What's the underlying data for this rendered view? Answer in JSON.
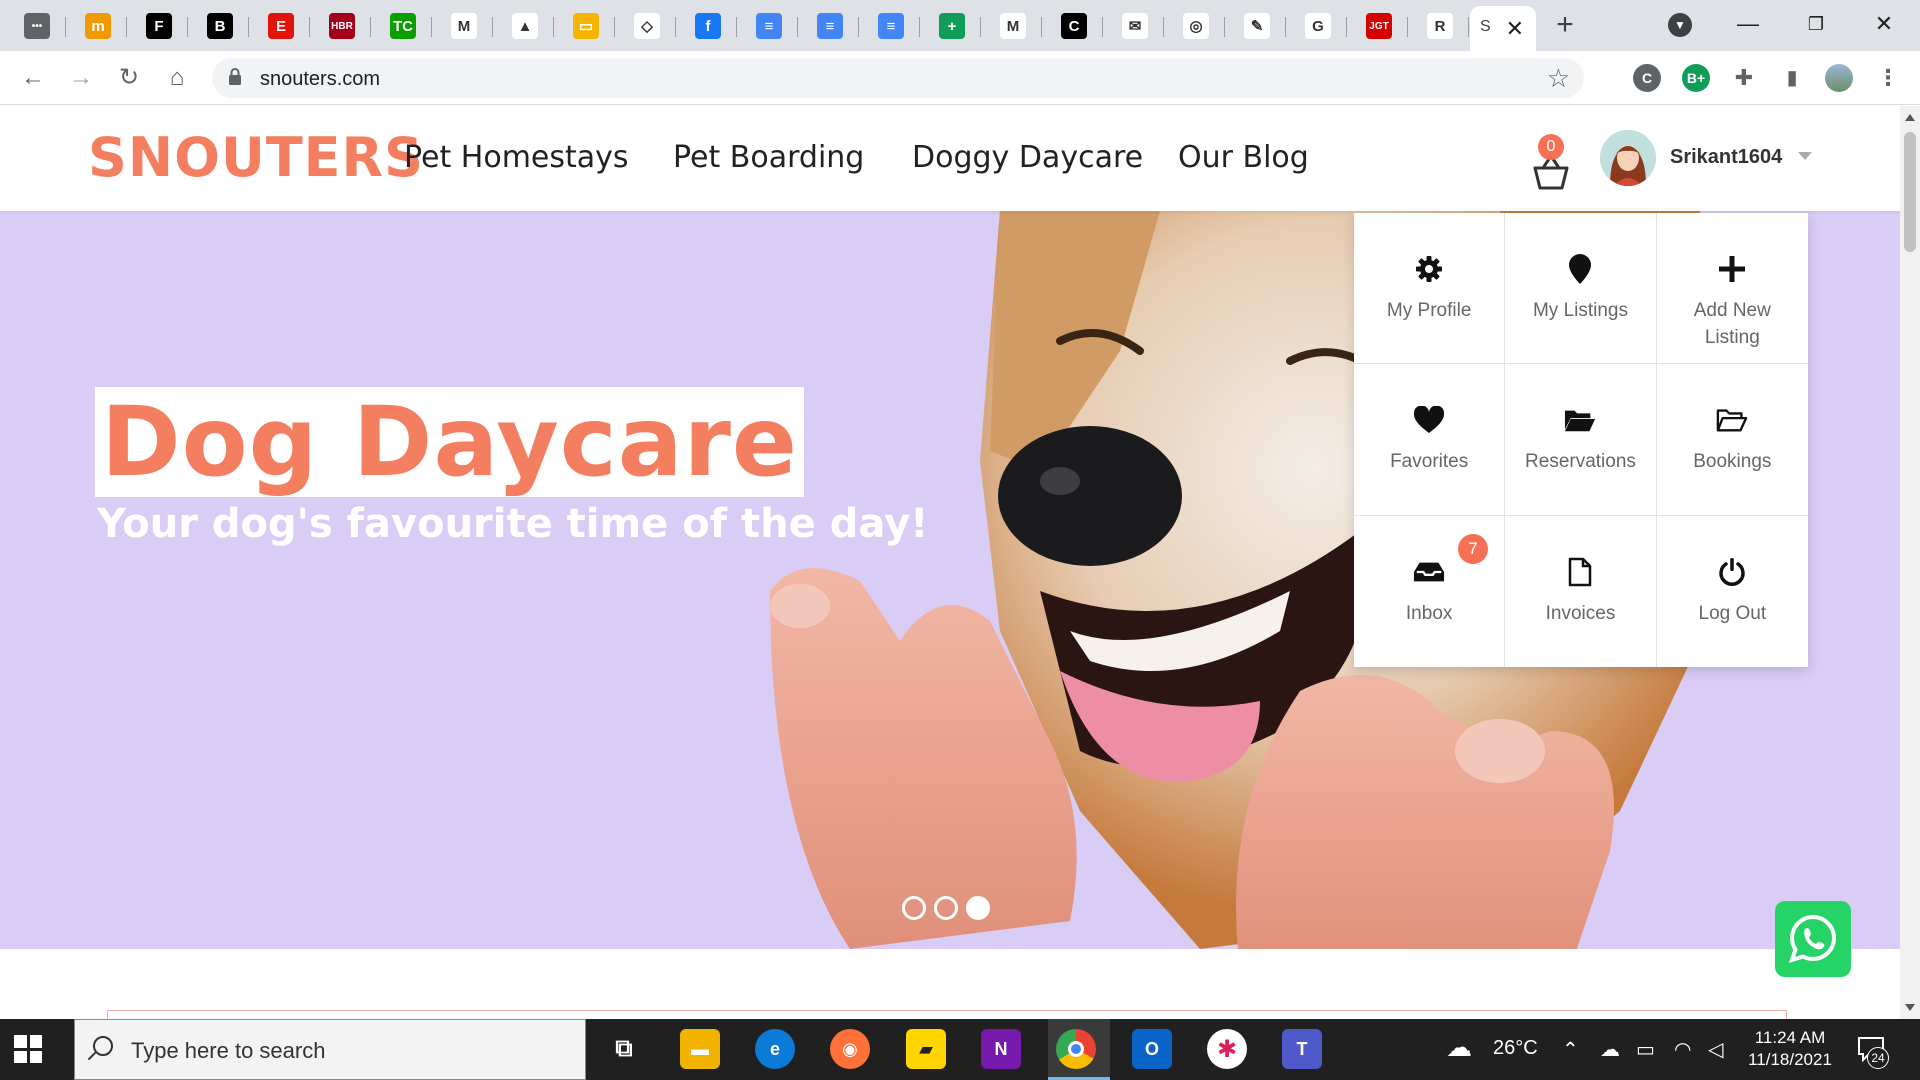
{
  "browser": {
    "tabs": [
      {
        "name": "apps",
        "glyph": "•••",
        "bg": "#5f6368"
      },
      {
        "name": "m",
        "glyph": "m",
        "bg": "#f29900"
      },
      {
        "name": "forbes",
        "glyph": "F",
        "bg": "#000000"
      },
      {
        "name": "b",
        "glyph": "B",
        "bg": "#000000"
      },
      {
        "name": "economist",
        "glyph": "E",
        "bg": "#e3120b"
      },
      {
        "name": "hbr",
        "glyph": "HBR",
        "bg": "#a4001c"
      },
      {
        "name": "techcrunch",
        "glyph": "TC",
        "bg": "#0a9e01"
      },
      {
        "name": "gmail",
        "glyph": "M",
        "bg": "#ffffff"
      },
      {
        "name": "drive",
        "glyph": "▲",
        "bg": "#ffffff"
      },
      {
        "name": "slides",
        "glyph": "▭",
        "bg": "#f4b400"
      },
      {
        "name": "diamond",
        "glyph": "◇",
        "bg": "#ffffff"
      },
      {
        "name": "facebook",
        "glyph": "f",
        "bg": "#1877f2"
      },
      {
        "name": "docs-1",
        "glyph": "≡",
        "bg": "#4285f4"
      },
      {
        "name": "docs-2",
        "glyph": "≡",
        "bg": "#4285f4"
      },
      {
        "name": "docs-3",
        "glyph": "≡",
        "bg": "#4285f4"
      },
      {
        "name": "sheets",
        "glyph": "+",
        "bg": "#0f9d58"
      },
      {
        "name": "miro",
        "glyph": "M",
        "bg": "#ffffff"
      },
      {
        "name": "c",
        "glyph": "C",
        "bg": "#000000"
      },
      {
        "name": "mail",
        "glyph": "✉",
        "bg": "#ffffff"
      },
      {
        "name": "ring",
        "glyph": "◎",
        "bg": "#ffffff"
      },
      {
        "name": "pen",
        "glyph": "✎",
        "bg": "#ffffff"
      },
      {
        "name": "copilot",
        "glyph": "G",
        "bg": "#ffffff"
      },
      {
        "name": "jgt",
        "glyph": "JGT",
        "bg": "#d50000"
      },
      {
        "name": "ai",
        "glyph": "R",
        "bg": "#ffffff"
      }
    ],
    "active_tab_label": "S",
    "url": "snouters.com"
  },
  "site": {
    "logo": "SNOUTERS",
    "nav": [
      "Pet Homestays",
      "Pet Boarding",
      "Doggy Daycare",
      "Our Blog"
    ],
    "cart_count": "0",
    "username": "Srikant1604"
  },
  "hero": {
    "title": "Dog Daycare",
    "subtitle": "Your dog's favourite time of the day!",
    "slide_count": 3,
    "active_slide": 3
  },
  "dropdown": {
    "items": [
      {
        "label": "My Profile",
        "icon": "gear-icon"
      },
      {
        "label": "My Listings",
        "icon": "map-pin-icon"
      },
      {
        "label": "Add New Listing",
        "icon": "plus-icon"
      },
      {
        "label": "Favorites",
        "icon": "heart-icon"
      },
      {
        "label": "Reservations",
        "icon": "folder-open-icon"
      },
      {
        "label": "Bookings",
        "icon": "folder-outline-icon"
      },
      {
        "label": "Inbox",
        "icon": "inbox-icon",
        "badge": "7"
      },
      {
        "label": "Invoices",
        "icon": "file-icon"
      },
      {
        "label": "Log Out",
        "icon": "power-icon"
      }
    ]
  },
  "taskbar": {
    "search_placeholder": "Type here to search",
    "weather": "26°C",
    "time": "11:24 AM",
    "date": "11/18/2021",
    "notifications": "24"
  },
  "colors": {
    "brand": "#f47f60",
    "badge": "#f57055",
    "hero_bg": "#d8ccf5",
    "whatsapp": "#25d366"
  }
}
